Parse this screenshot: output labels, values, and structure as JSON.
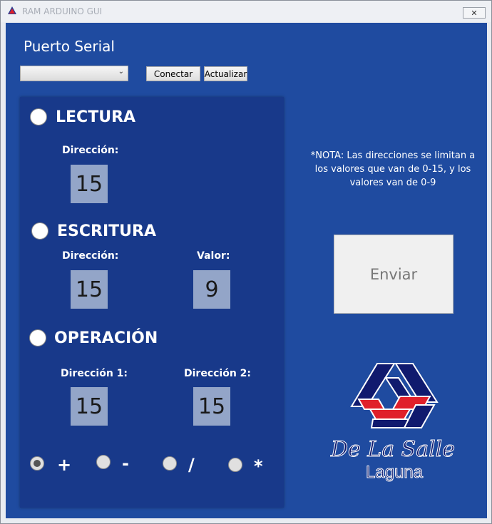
{
  "window": {
    "title": "RAM ARDUINO GUI",
    "close_glyph": "✕"
  },
  "serial": {
    "label": "Puerto Serial",
    "combo_value": "",
    "connect_label": "Conectar",
    "refresh_label": "Actualizar"
  },
  "lectura": {
    "title": "LECTURA",
    "selected": false,
    "address_label": "Dirección:",
    "address_value": "15"
  },
  "escritura": {
    "title": "ESCRITURA",
    "selected": false,
    "address_label": "Dirección:",
    "address_value": "15",
    "value_label": "Valor:",
    "value_value": "9"
  },
  "operacion": {
    "title": "OPERACIÓN",
    "selected": false,
    "address1_label": "Dirección 1:",
    "address1_value": "15",
    "address2_label": "Dirección 2:",
    "address2_value": "15",
    "operators": [
      {
        "symbol": "+",
        "selected": true
      },
      {
        "symbol": "-",
        "selected": false
      },
      {
        "symbol": "/",
        "selected": false
      },
      {
        "symbol": "*",
        "selected": false
      }
    ]
  },
  "note": "*NOTA: Las direcciones se limitan a los valores que van de 0-15, y los valores van de 0-9",
  "send_label": "Enviar",
  "logo": {
    "script_text": "De La Salle",
    "sub_text": "Laguna"
  },
  "colors": {
    "background": "#1f4ba0",
    "panel": "#18398a",
    "number_box": "#93a5c8",
    "logo_red": "#e0202a",
    "logo_navy": "#101a6e"
  }
}
